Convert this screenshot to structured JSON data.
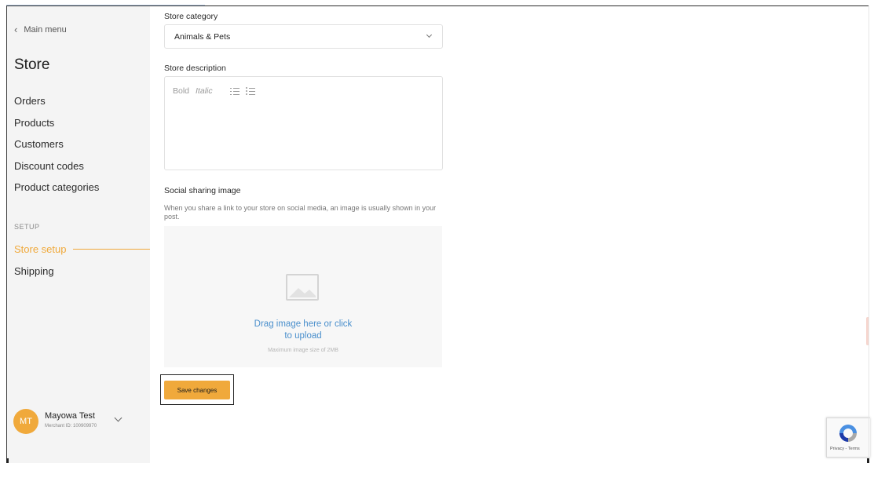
{
  "sidebar": {
    "back_label": "Main menu",
    "title": "Store",
    "items": [
      "Orders",
      "Products",
      "Customers",
      "Discount codes",
      "Product categories"
    ],
    "setup_heading": "SETUP",
    "setup_items": [
      "Store setup",
      "Shipping"
    ],
    "active_item": "Store setup",
    "user": {
      "initials": "MT",
      "name": "Mayowa Test",
      "merchant_id": "Merchant ID: 100909970"
    }
  },
  "form": {
    "category_label": "Store category",
    "category_value": "Animals & Pets",
    "description_label": "Store description",
    "toolbar": {
      "bold": "Bold",
      "italic": "Italic"
    },
    "social_label": "Social sharing image",
    "social_help": "When you share a link to your store on social media, an image is usually shown in your post.",
    "upload_line1": "Drag image here or click",
    "upload_line2": "to upload",
    "upload_hint": "Maximum image size of 2MB",
    "save_label": "Save changes"
  },
  "recaptcha": {
    "links": "Privacy - Terms"
  },
  "colors": {
    "accent": "#f0a93b",
    "link": "#4a8fcc",
    "sidebar_bg": "#f4f4f4"
  }
}
